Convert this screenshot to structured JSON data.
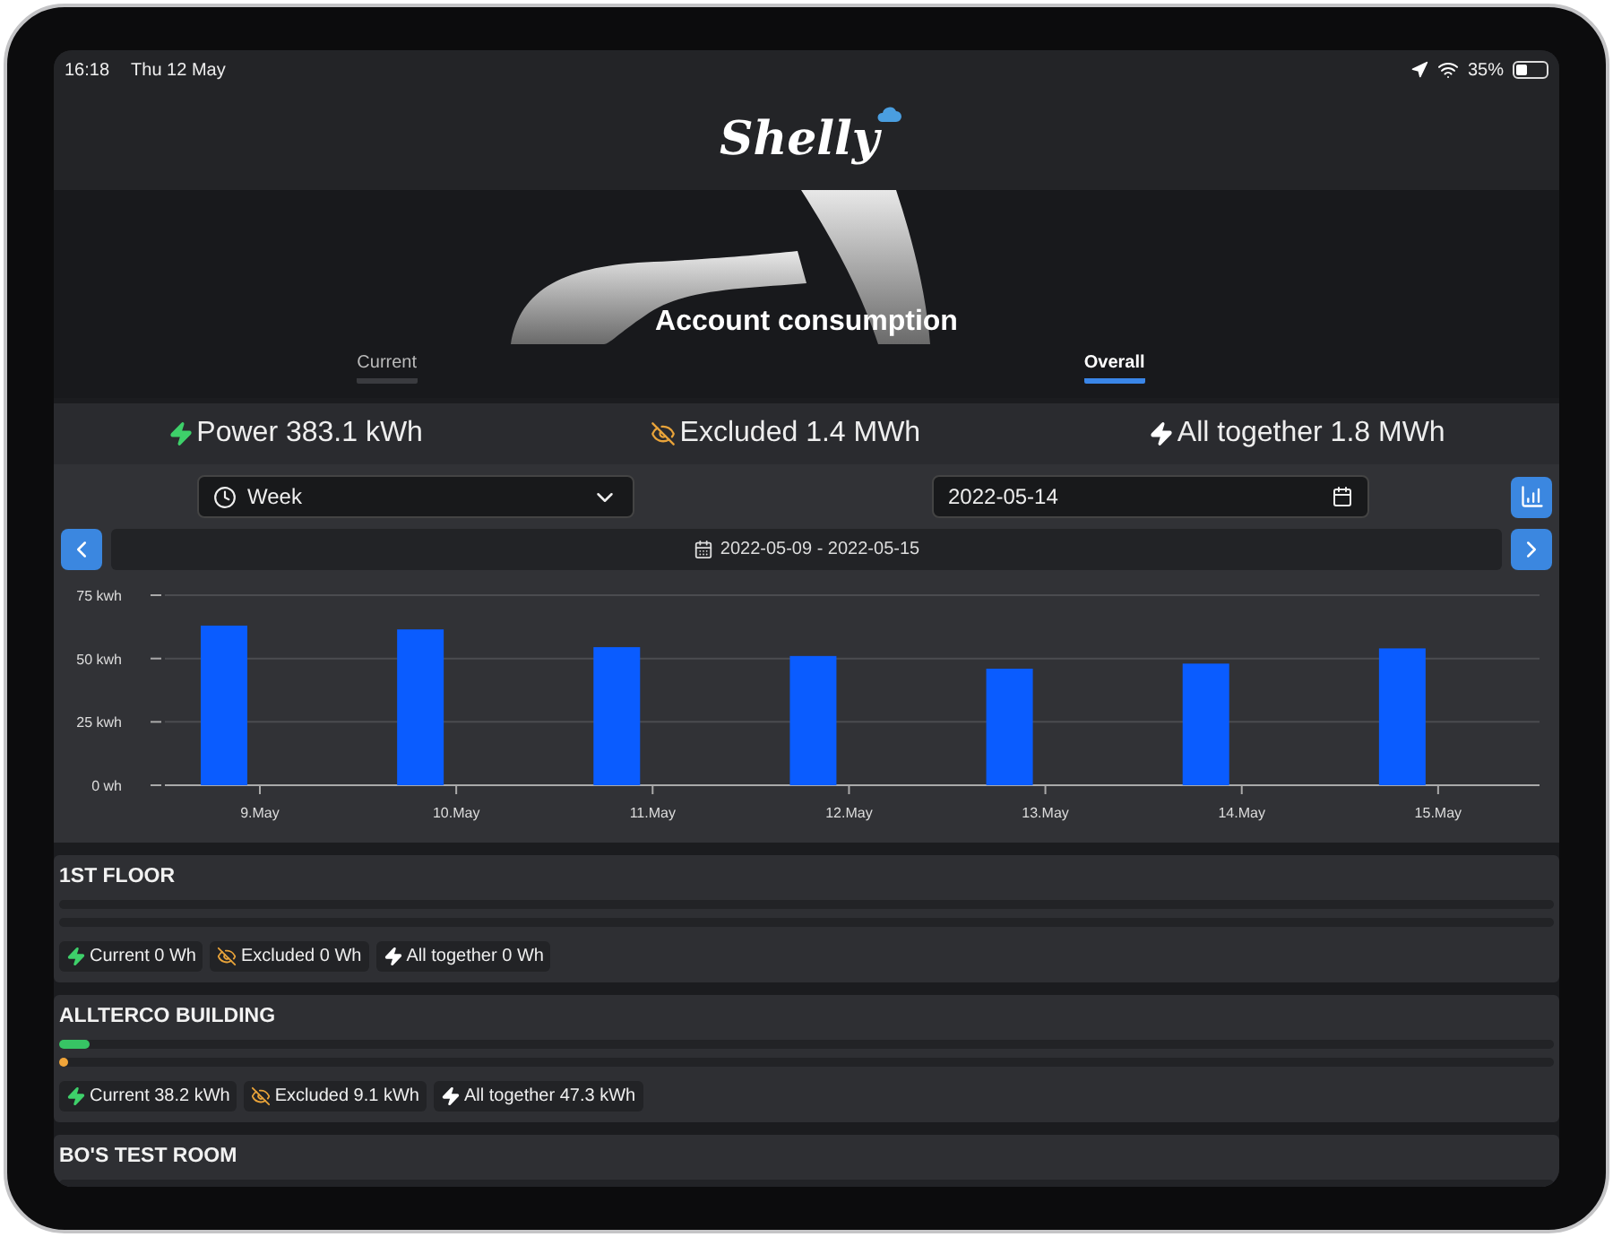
{
  "status_bar": {
    "time": "16:18",
    "date": "Thu 12 May",
    "battery": "35%"
  },
  "header": {
    "logo": "Shelly"
  },
  "hero": {
    "title": "Account consumption"
  },
  "tabs": [
    {
      "label": "Current",
      "selected": false
    },
    {
      "label": "Overall",
      "selected": true
    }
  ],
  "totals": [
    {
      "kind": "current",
      "text": "Power 383.1 kWh"
    },
    {
      "kind": "excluded",
      "text": "Excluded 1.4 MWh"
    },
    {
      "kind": "total",
      "text": "All together 1.8 MWh"
    }
  ],
  "controls": {
    "period": "Week",
    "date": "2022-05-14",
    "range": "2022-05-09 - 2022-05-15"
  },
  "chart_data": {
    "type": "bar",
    "categories": [
      "9.May",
      "10.May",
      "11.May",
      "12.May",
      "13.May",
      "14.May",
      "15.May"
    ],
    "series": [
      {
        "color": "#0a5cff",
        "values": [
          63,
          61.5,
          54.5,
          51,
          46,
          48,
          54
        ]
      }
    ],
    "ylim": [
      0,
      75
    ],
    "yticks": [
      {
        "value": 0,
        "label": "0 wh"
      },
      {
        "value": 25,
        "label": "25 kwh"
      },
      {
        "value": 50,
        "label": "50 kwh"
      },
      {
        "value": 75,
        "label": "75 kwh"
      }
    ]
  },
  "rooms": [
    {
      "name": "1ST FLOOR",
      "chips": [
        {
          "kind": "current",
          "text": "Current 0 Wh"
        },
        {
          "kind": "excluded",
          "text": "Excluded 0 Wh"
        },
        {
          "kind": "total",
          "text": "All together 0 Wh"
        }
      ]
    },
    {
      "name": "ALLTERCO BUILDING",
      "bars": [
        {
          "kind": "current",
          "level": 0.02
        },
        {
          "kind": "excluded",
          "level": 0.005
        }
      ],
      "chips": [
        {
          "kind": "current",
          "text": "Current 38.2 kWh"
        },
        {
          "kind": "excluded",
          "text": "Excluded 9.1 kWh"
        },
        {
          "kind": "total",
          "text": "All together 47.3 kWh"
        }
      ]
    },
    {
      "name": "BO'S TEST ROOM"
    }
  ]
}
